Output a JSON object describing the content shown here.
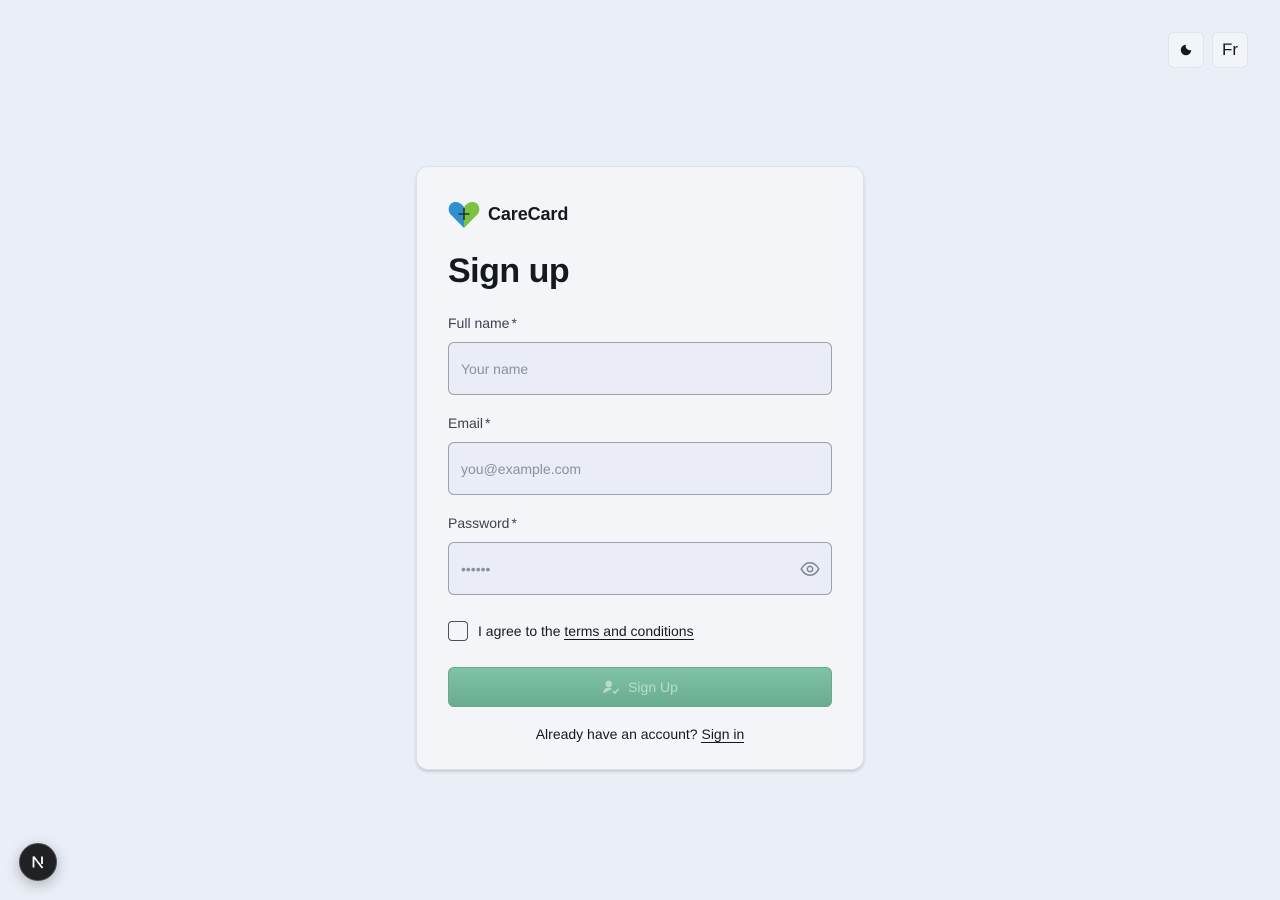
{
  "top_controls": {
    "language_label": "Fr"
  },
  "brand": {
    "name": "CareCard"
  },
  "title": "Sign up",
  "fields": {
    "full_name": {
      "label": "Full name",
      "required": "*",
      "placeholder": "Your name"
    },
    "email": {
      "label": "Email",
      "required": "*",
      "placeholder": "you@example.com"
    },
    "password": {
      "label": "Password",
      "required": "*",
      "placeholder": "••••••"
    }
  },
  "agree": {
    "prefix": "I agree to the",
    "link": "terms and conditions"
  },
  "submit": {
    "label": "Sign Up"
  },
  "signin": {
    "prompt": "Already have an account?",
    "link": "Sign in"
  },
  "colors": {
    "accent": "#72b597",
    "background": "#eaeef6",
    "card": "#f3f5f9"
  },
  "icons": [
    "moon-icon",
    "heart-logo-icon",
    "eye-icon",
    "user-check-icon",
    "next-logo-icon"
  ]
}
